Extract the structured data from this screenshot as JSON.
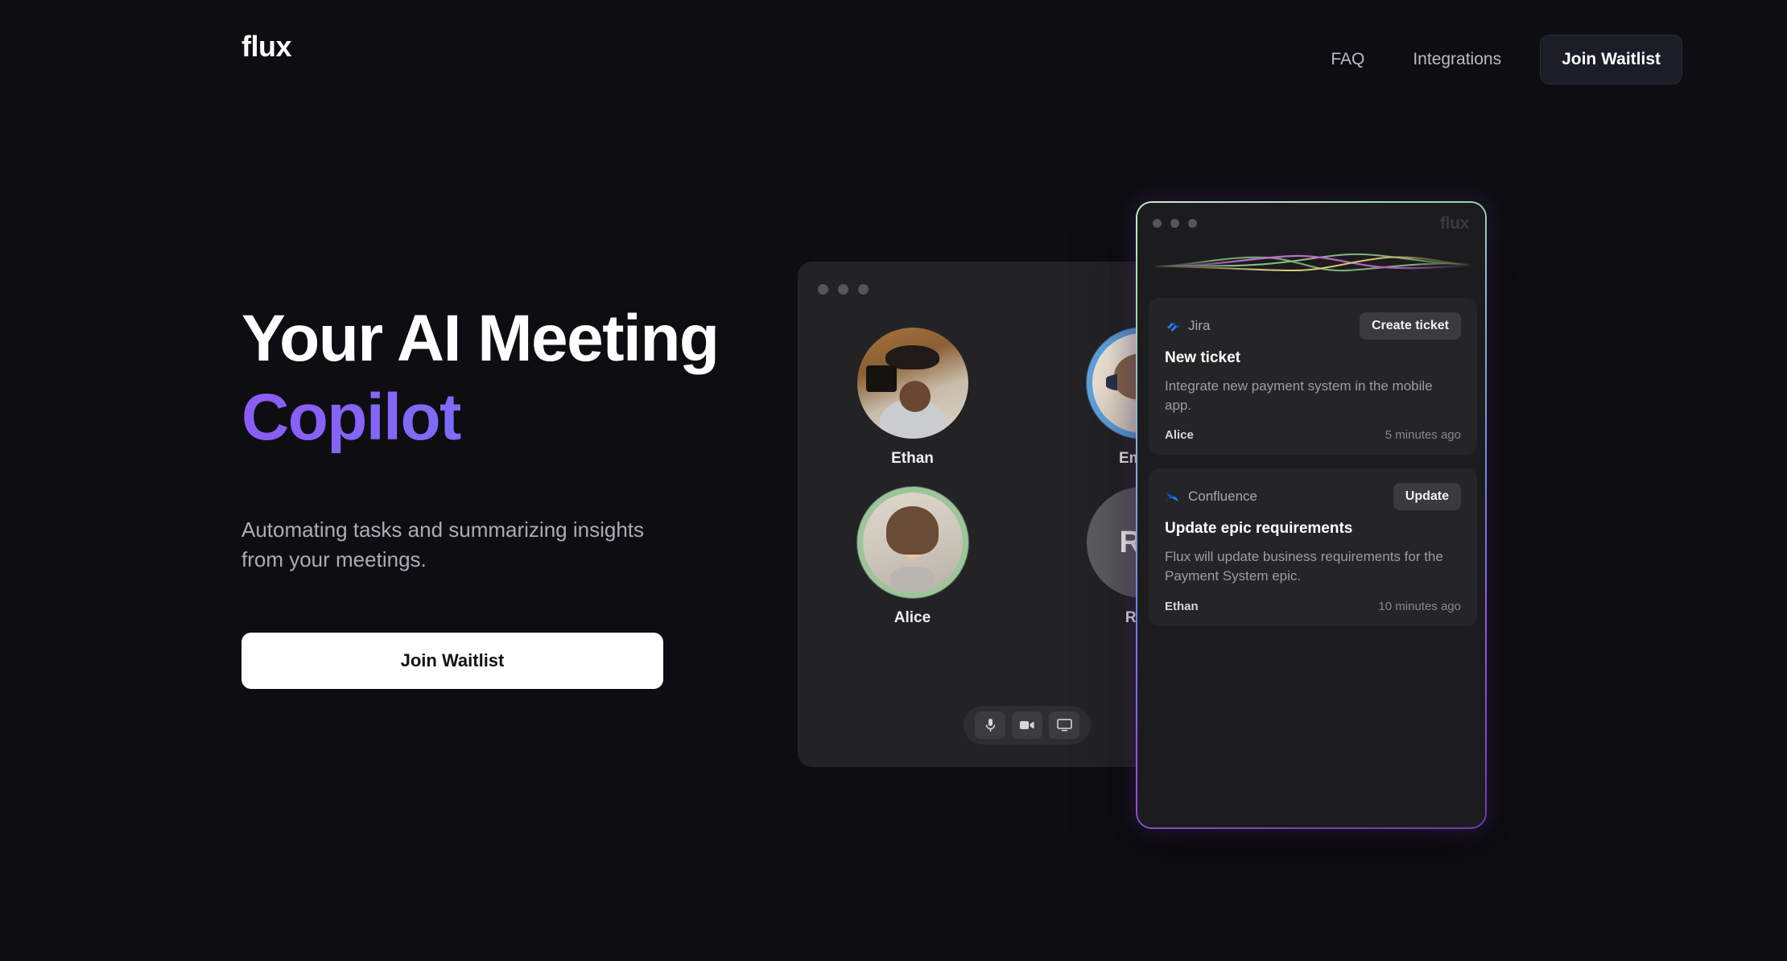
{
  "brand": {
    "logo": "flux"
  },
  "nav": {
    "links": [
      {
        "label": "FAQ",
        "name": "nav-link-faq"
      },
      {
        "label": "Integrations",
        "name": "nav-link-integrations"
      }
    ],
    "cta_label": "Join Waitlist"
  },
  "hero": {
    "headline_line1": "Your AI Meeting",
    "headline_line2": "Copilot",
    "subtitle": "Automating tasks and summarizing insights from your meetings.",
    "cta_label": "Join Waitlist",
    "gradient_start": "#8b5cf6",
    "gradient_end": "#63a4f7"
  },
  "meeting": {
    "participants": [
      {
        "name": "Ethan",
        "type": "photo",
        "ring": "none",
        "initials": ""
      },
      {
        "name": "Emma",
        "type": "photo",
        "ring": "blue",
        "initials": ""
      },
      {
        "name": "Alice",
        "type": "photo",
        "ring": "green",
        "initials": ""
      },
      {
        "name": "Raul",
        "type": "initials",
        "ring": "none",
        "initials": "RA"
      }
    ],
    "ring_colors": {
      "speaking_blue": "#5ea3e0",
      "speaking_green": "#9dc49a"
    },
    "controls": [
      {
        "icon": "microphone-icon"
      },
      {
        "icon": "video-camera-icon"
      },
      {
        "icon": "screen-share-icon"
      }
    ]
  },
  "assistant": {
    "watermark": "flux",
    "waveform_colors": [
      "#6f9e6a",
      "#c46fd0",
      "#d8cf77",
      "#8fbf88"
    ],
    "border_gradient": [
      "#cfe8c8",
      "#7a7de0",
      "#8b4ed6"
    ],
    "cards": [
      {
        "source": "Jira",
        "source_icon": "jira-icon",
        "action_label": "Create ticket",
        "title": "New ticket",
        "body": "Integrate new payment system in the mobile app.",
        "author": "Alice",
        "time": "5 minutes ago"
      },
      {
        "source": "Confluence",
        "source_icon": "confluence-icon",
        "action_label": "Update",
        "title": "Update epic requirements",
        "body": "Flux will update business requirements for the Payment System epic.",
        "author": "Ethan",
        "time": "10 minutes ago"
      }
    ]
  }
}
